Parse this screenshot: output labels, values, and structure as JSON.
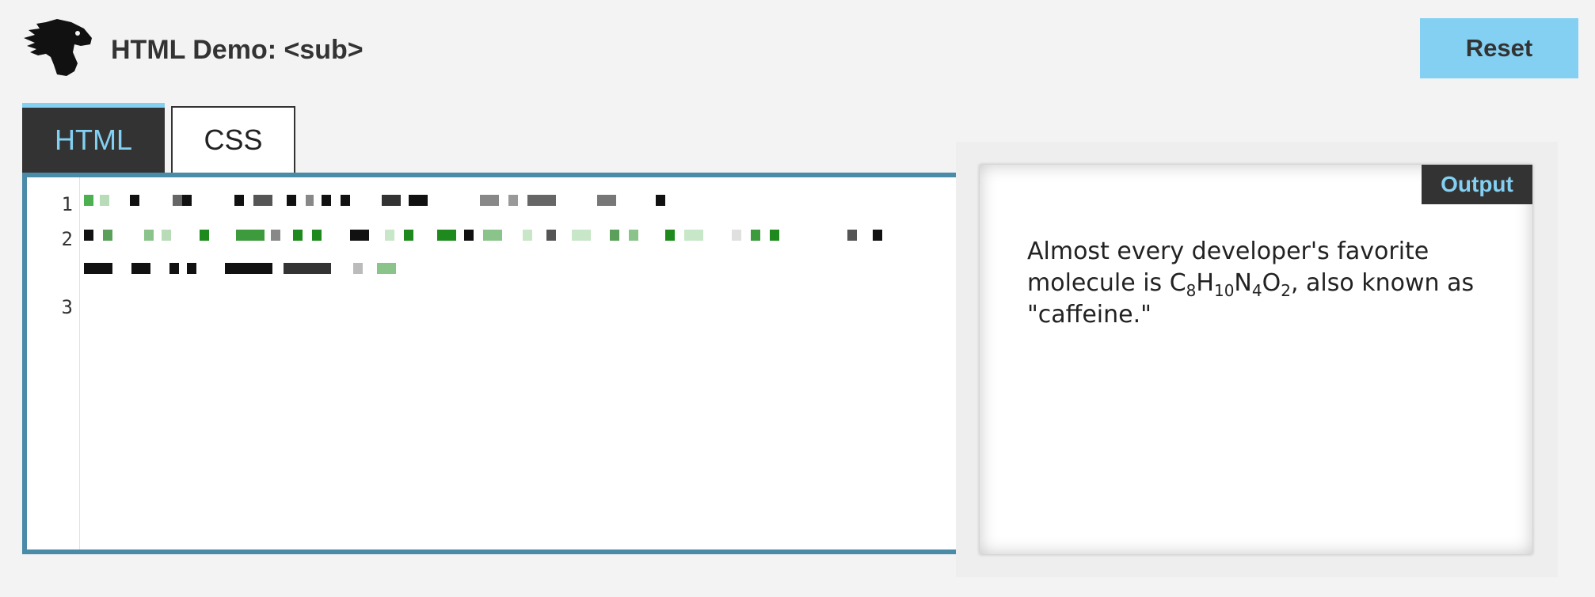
{
  "header": {
    "title": "HTML Demo: <sub>",
    "reset_label": "Reset",
    "logo_icon": "dinosaur-icon"
  },
  "tabs": [
    {
      "label": "HTML",
      "active": true
    },
    {
      "label": "CSS",
      "active": false
    }
  ],
  "editor": {
    "line_numbers": [
      "1",
      "2",
      "3"
    ]
  },
  "output": {
    "label": "Output",
    "text_before": "Almost every developer's favorite molecule is ",
    "formula": [
      {
        "el": "C",
        "n": "8"
      },
      {
        "el": "H",
        "n": "10"
      },
      {
        "el": "N",
        "n": "4"
      },
      {
        "el": "O",
        "n": "2"
      }
    ],
    "text_after": ", also known as \"caffeine.\""
  },
  "colors": {
    "accent": "#83d0f2",
    "dark": "#333333",
    "editor_border": "#4a8ba8",
    "page_bg": "#f3f3f3"
  }
}
